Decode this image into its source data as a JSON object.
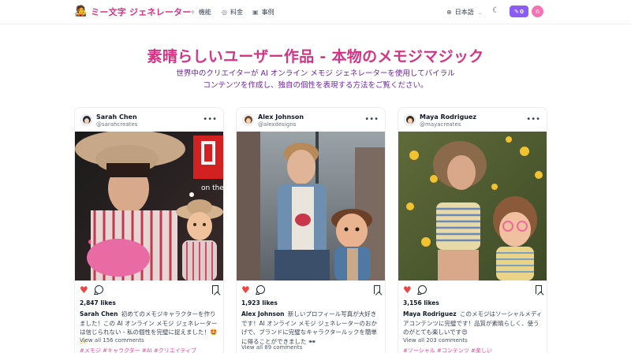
{
  "brand": {
    "name": "ミー文字 ジェネレーター",
    "emoji": "🧑‍🎤"
  },
  "nav": {
    "features": "機能",
    "pricing": "料金",
    "cases": "事例",
    "language": "日本語",
    "credits": "0",
    "avatar_letter": "n"
  },
  "icons": {
    "features": "sparkles-icon",
    "pricing": "coin-icon",
    "cases": "gift-icon",
    "language": "globe-icon",
    "theme": "moon-icon",
    "credits": "pencil-icon"
  },
  "colors": {
    "accent": "#d63384",
    "credits_bg": "#8b5cf6",
    "avatar_bg": "#f472b6",
    "like": "#ef4444",
    "tags": "#ec4899"
  },
  "hero": {
    "title": "素晴らしいユーザー作品 - 本物のメモジマジック",
    "subtitle_line1": "世界中のクリエイターが AI オンライン メモジ ジェネレーターを使用してバイラル",
    "subtitle_line2": "コンテンツを作成し、独自の個性を表現する方法をご覧ください。"
  },
  "posts": [
    {
      "name": "Sarah Chen",
      "handle": "@sarahcreates",
      "likes": "2,847 likes",
      "caption_author": "Sarah Chen",
      "caption": "初めてのメモジキャラクターを作りました！この AI オンライン メモジ ジェネレーターは信じられない - 私の個性を完璧に捉えました！🤩✨",
      "comments": "View all 156 comments",
      "tags": "#メモジ #キャラクター #AI #クリエイティブ"
    },
    {
      "name": "Alex Johnson",
      "handle": "@alexdesigns",
      "likes": "1,923 likes",
      "caption_author": "Alex Johnson",
      "caption": "新しいプロフィール写真が大好きです！AI オンライン メモジ ジェネレーターのおかげで、ブランドに完璧なキャラクタールックを簡単に得ることができました 🕶",
      "comments": "View all 89 comments",
      "tags": ""
    },
    {
      "name": "Maya Rodriguez",
      "handle": "@mayacreates",
      "likes": "3,156 likes",
      "caption_author": "Maya Rodriguez",
      "caption": "このメモジはソーシャルメディアコンテンツに完璧です！品質が素晴らしく、使うのがとても楽しいです😍",
      "comments": "View all 203 comments",
      "tags": "#ソーシャル #コンテンツ #楽しい"
    }
  ]
}
